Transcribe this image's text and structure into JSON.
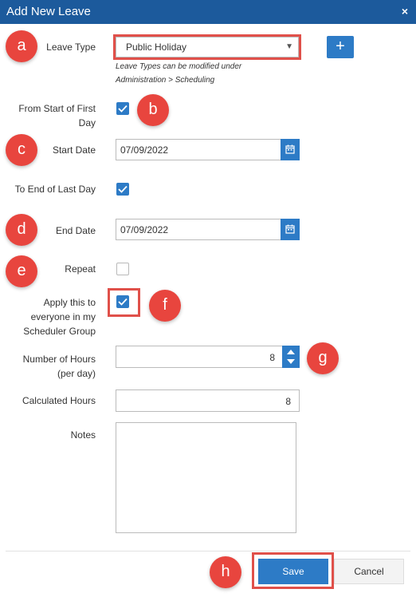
{
  "window": {
    "title": "Add New Leave",
    "close_symbol": "×"
  },
  "form": {
    "leave_type": {
      "label": "Leave Type",
      "value": "Public Holiday",
      "hint_line1": "Leave Types can be modified under",
      "hint_line2": "Administration > Scheduling"
    },
    "from_start": {
      "label_line1": "From Start of First",
      "label_line2": "Day",
      "checked": true
    },
    "start_date": {
      "label": "Start Date",
      "value": "07/09/2022"
    },
    "to_end": {
      "label": "To End of Last Day",
      "checked": true
    },
    "end_date": {
      "label": "End Date",
      "value": "07/09/2022"
    },
    "repeat": {
      "label": "Repeat",
      "checked": false
    },
    "apply_all": {
      "label_line1": "Apply this to",
      "label_line2": "everyone in my",
      "label_line3": "Scheduler Group",
      "checked": true
    },
    "hours": {
      "label_line1": "Number of Hours",
      "label_line2": "(per day)",
      "value": "8"
    },
    "calculated": {
      "label": "Calculated Hours",
      "value": "8"
    },
    "notes": {
      "label": "Notes",
      "value": ""
    }
  },
  "footer": {
    "save_label": "Save",
    "cancel_label": "Cancel"
  },
  "callouts": {
    "a": "a",
    "b": "b",
    "c": "c",
    "d": "d",
    "e": "e",
    "f": "f",
    "g": "g",
    "h": "h"
  },
  "colors": {
    "title_bar": "#1c5a9c",
    "accent": "#2d7bc6",
    "callout": "#e8453e"
  }
}
